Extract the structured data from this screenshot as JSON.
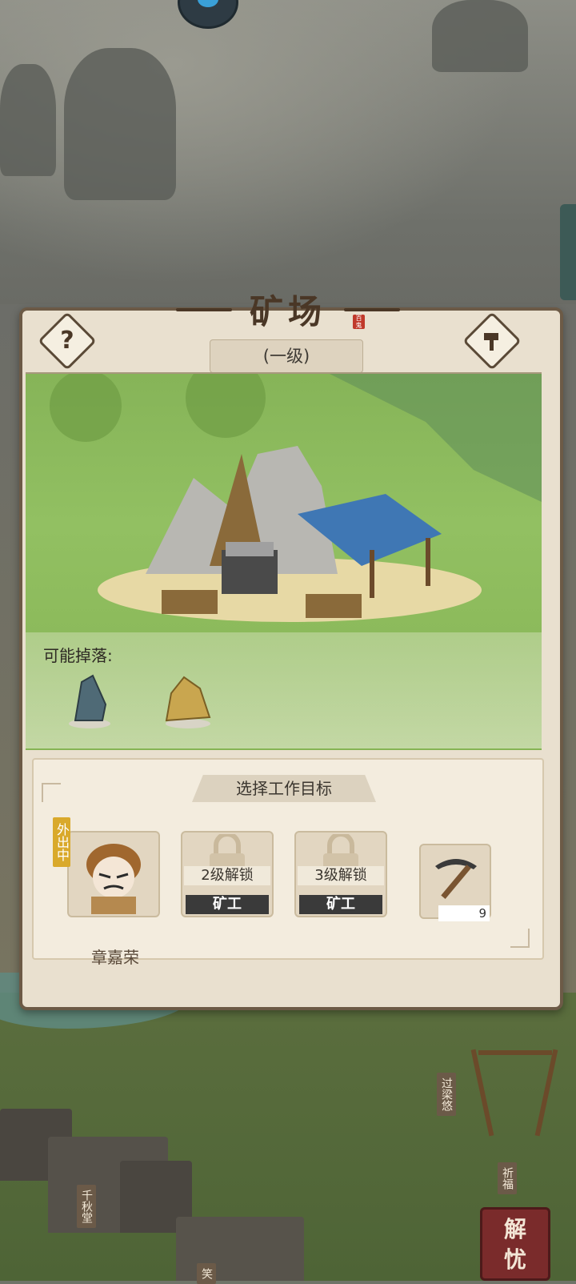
{
  "building": {
    "title": "矿场",
    "seal_text": "百鬼",
    "level": "(一级)"
  },
  "drops": {
    "label": "可能掉落:",
    "items": [
      "iron-ore-icon",
      "gold-ore-icon"
    ]
  },
  "work": {
    "tab_label": "选择工作目标",
    "worker": {
      "status": "外出中",
      "name": "章嘉荣"
    },
    "slots": [
      {
        "unlock": "2级解锁",
        "role": "矿工"
      },
      {
        "unlock": "3级解锁",
        "role": "矿工"
      }
    ],
    "tool": {
      "icon": "pickaxe-icon",
      "count": "9"
    }
  },
  "map_signs": [
    "过梁悠",
    "千秋堂",
    "祈福",
    "笑"
  ],
  "resolve_button": "解忧",
  "colors": {
    "panel_bg": "#e9e0cf",
    "panel_border": "#6c5a46",
    "title_text": "#4a3726",
    "status_badge": "#d9a92b",
    "role_band": "#3a3a3a"
  }
}
